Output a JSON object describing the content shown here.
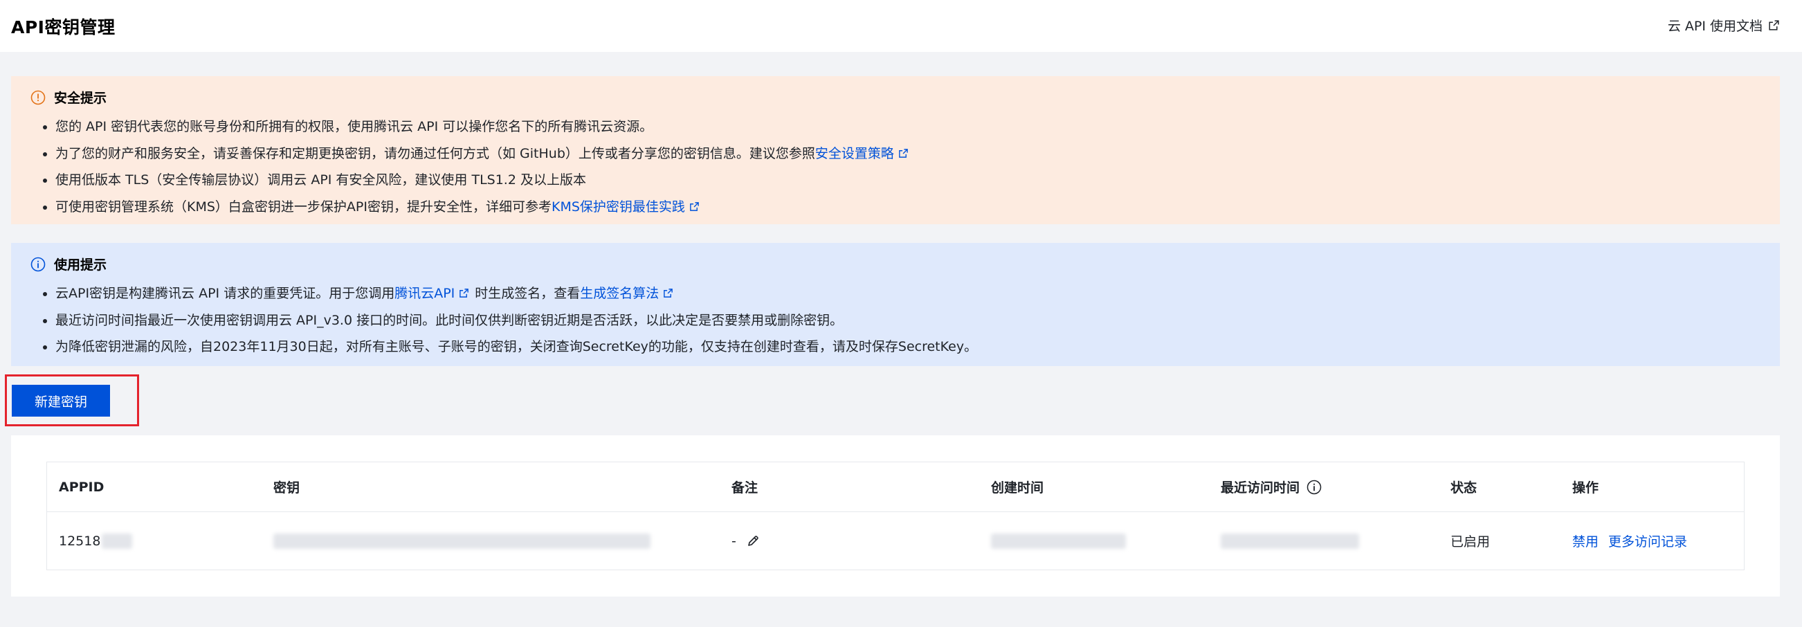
{
  "header": {
    "title": "API密钥管理",
    "doc_link": "云 API 使用文档"
  },
  "security_notice": {
    "title": "安全提示",
    "items": [
      {
        "text": "您的 API 密钥代表您的账号身份和所拥有的权限，使用腾讯云 API 可以操作您名下的所有腾讯云资源。"
      },
      {
        "text": "为了您的财产和服务安全，请妥善保存和定期更换密钥，请勿通过任何方式（如 GitHub）上传或者分享您的密钥信息。建议您参照",
        "link": "安全设置策略"
      },
      {
        "text": "使用低版本 TLS（安全传输层协议）调用云 API 有安全风险，建议使用 TLS1.2 及以上版本"
      },
      {
        "text": "可使用密钥管理系统（KMS）白盒密钥进一步保护API密钥，提升安全性，详细可参考",
        "link": "KMS保护密钥最佳实践"
      }
    ]
  },
  "usage_notice": {
    "title": "使用提示",
    "items": [
      {
        "pre": "云API密钥是构建腾讯云 API 请求的重要凭证。用于您调用",
        "link1": "腾讯云API",
        "mid": "时生成签名，查看",
        "link2": "生成签名算法"
      },
      {
        "text": "最近访问时间指最近一次使用密钥调用云 API_v3.0 接口的时间。此时间仅供判断密钥近期是否活跃，以此决定是否要禁用或删除密钥。"
      },
      {
        "text": "为降低密钥泄漏的风险，自2023年11月30日起，对所有主账号、子账号的密钥，关闭查询SecretKey的功能，仅支持在创建时查看，请及时保存SecretKey。"
      }
    ]
  },
  "toolbar": {
    "create_label": "新建密钥"
  },
  "table": {
    "columns": [
      "APPID",
      "密钥",
      "备注",
      "创建时间",
      "最近访问时间",
      "状态",
      "操作"
    ],
    "rows": [
      {
        "appid": "12518",
        "remark": "-",
        "status": "已启用",
        "actions": [
          "禁用",
          "更多访问记录"
        ]
      }
    ]
  },
  "colors": {
    "primary": "#0052d9",
    "warning_bg": "#fdebe0",
    "info_bg": "#dfe9fc",
    "success": "#2ba471",
    "highlight": "#e4232d"
  }
}
